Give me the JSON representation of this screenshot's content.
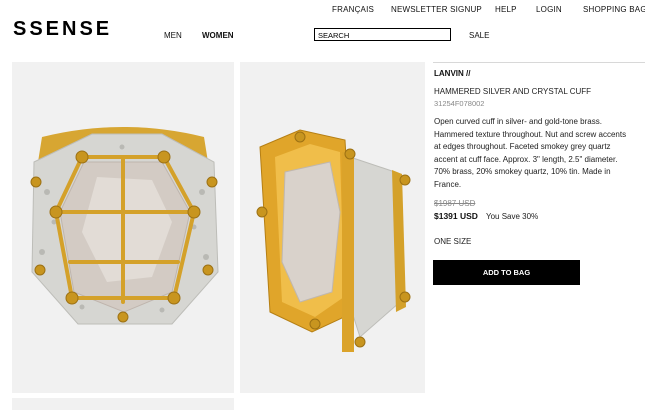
{
  "top_links": [
    "FRANÇAIS",
    "NEWSLETTER SIGNUP",
    "HELP",
    "LOGIN",
    "SHOPPING BAG"
  ],
  "logo": "SSENSE",
  "nav": {
    "men": "MEN",
    "women": "WOMEN",
    "sale": "SALE"
  },
  "search": {
    "value": "SEARCH"
  },
  "product": {
    "brand": "LANVIN //",
    "title": "HAMMERED SILVER AND CRYSTAL CUFF",
    "sku": "31254F078002",
    "description": "Open curved cuff in silver- and gold-tone brass. Hammered texture throughout. Nut and screw accents at edges throughout. Faceted smokey grey quartz accent at cuff face. Approx. 3\" length, 2.5\" diameter. 70% brass, 20% smokey quartz, 10% tin. Made in France.",
    "original_price": "$1987 USD",
    "sale_price": "$1391 USD",
    "savings": "You Save 30%",
    "size": "ONE SIZE",
    "add_to_bag": "ADD TO BAG"
  },
  "colors": {
    "gold": "#d9a62c",
    "silver": "#d8d8d4",
    "panel_bg": "#f1f1f1",
    "button_bg": "#000000"
  }
}
